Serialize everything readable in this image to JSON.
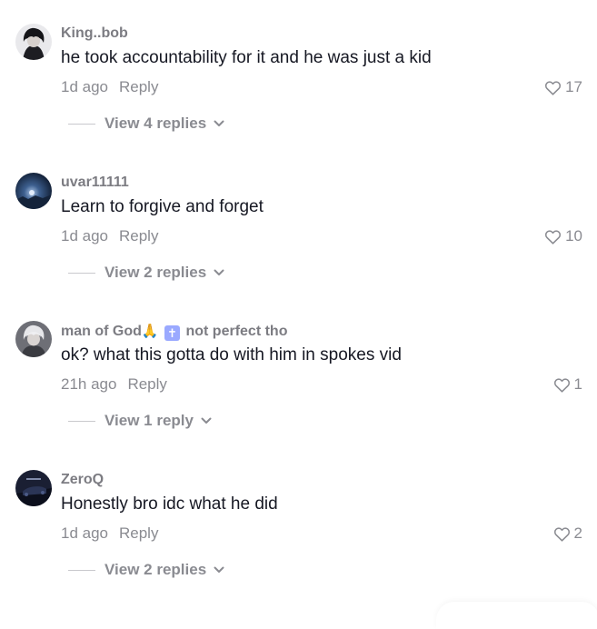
{
  "comments": [
    {
      "username": "King..bob",
      "text": "he took accountability for it and he was just a kid",
      "time": "1d ago",
      "reply_label": "Reply",
      "likes": "17",
      "view_replies": "View 4 replies",
      "avatar": "dark-hair-character-avatar"
    },
    {
      "username": "uvar11111",
      "text": "Learn to forgive and forget",
      "time": "1d ago",
      "reply_label": "Reply",
      "likes": "10",
      "view_replies": "View 2 replies",
      "avatar": "blue-night-scene-avatar"
    },
    {
      "username_prefix": "man of God",
      "username_emoji_1": "🙏",
      "username_emoji_2": "✝",
      "username_suffix": "not perfect tho",
      "text": "ok? what this gotta do with him in spokes vid",
      "time": "21h ago",
      "reply_label": "Reply",
      "likes": "1",
      "view_replies": "View 1 reply",
      "avatar": "white-hair-character-avatar"
    },
    {
      "username": "ZeroQ",
      "text": "Honestly bro idc what he did",
      "time": "1d ago",
      "reply_label": "Reply",
      "likes": "2",
      "view_replies": "View 2 replies",
      "avatar": "dark-car-avatar"
    }
  ],
  "icons": {
    "like": "heart-outline-icon",
    "expand": "chevron-down-icon"
  },
  "colors": {
    "username": "#7c7c82",
    "text": "#161823",
    "meta": "#8a8b91"
  }
}
